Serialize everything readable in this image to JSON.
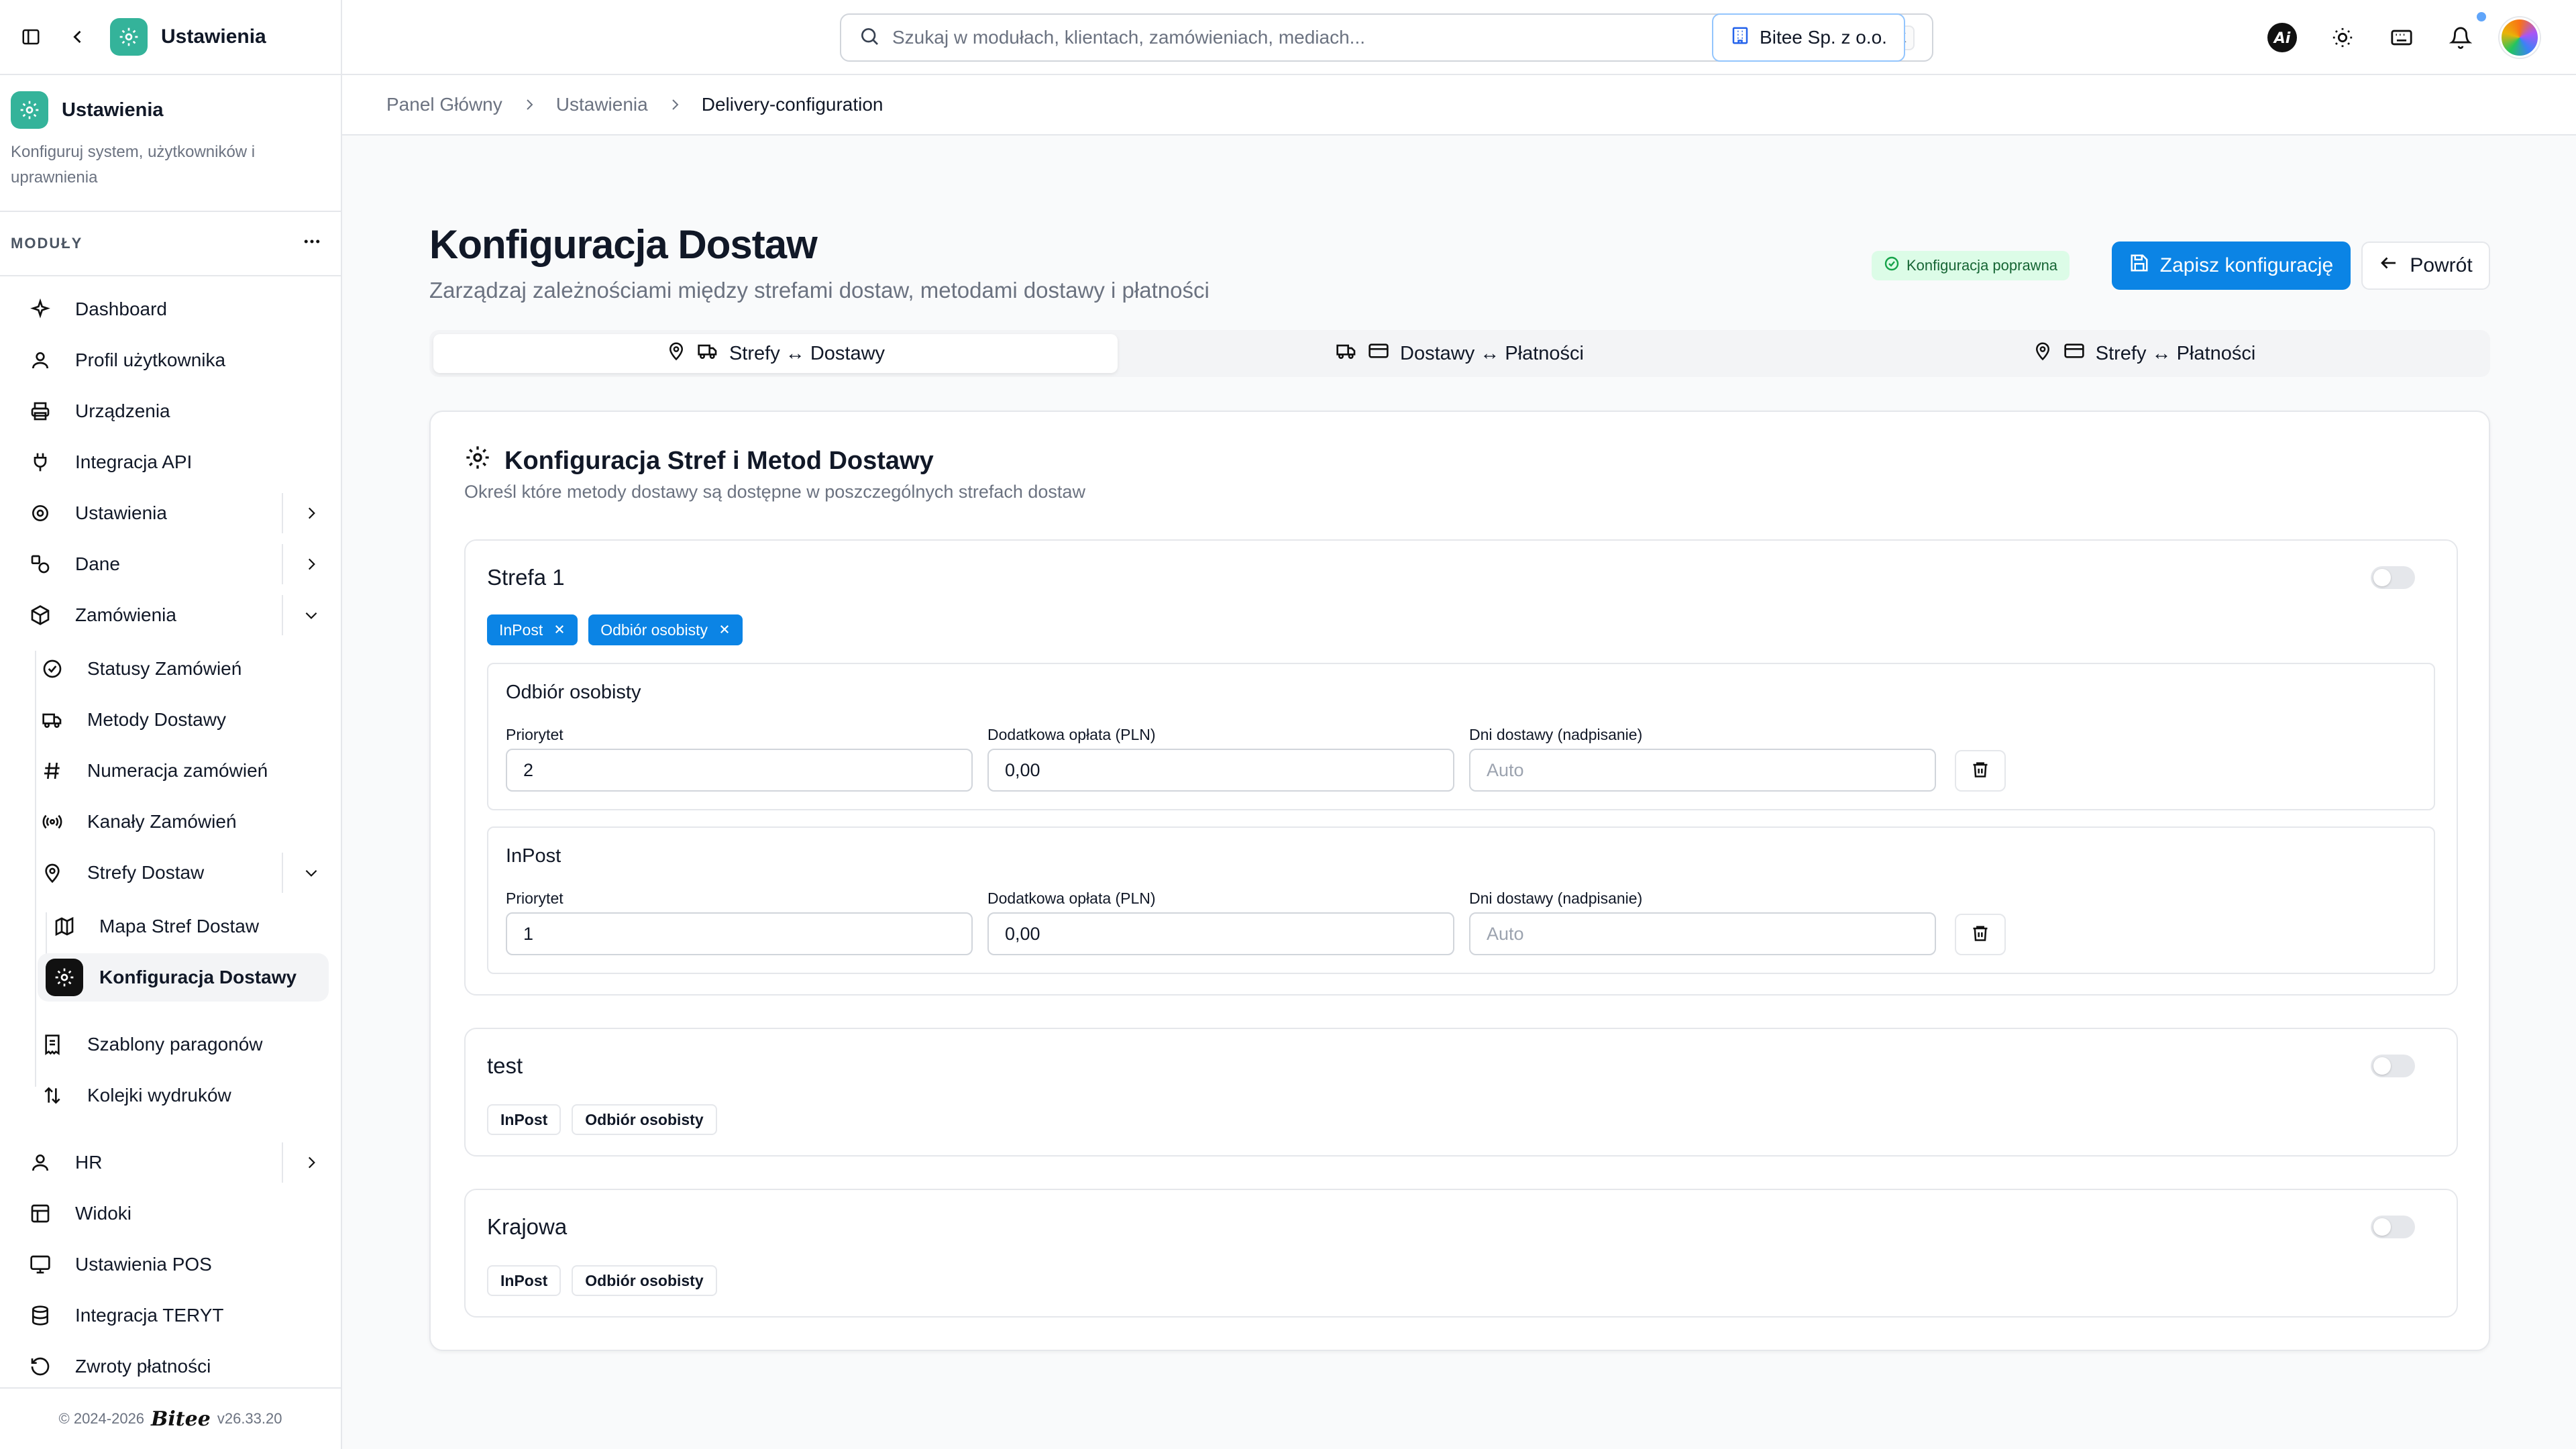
{
  "sidebar": {
    "top_title": "Ustawienia",
    "section_title": "Ustawienia",
    "section_desc": "Konfiguruj system, użytkowników i uprawnienia",
    "modules_label": "MODUŁY",
    "items": [
      {
        "label": "Dashboard",
        "icon": "sparkles-icon"
      },
      {
        "label": "Profil użytkownika",
        "icon": "user-icon"
      },
      {
        "label": "Urządzenia",
        "icon": "printer-icon"
      },
      {
        "label": "Integracja API",
        "icon": "plug-icon"
      },
      {
        "label": "Ustawienia",
        "icon": "gear-icon"
      },
      {
        "label": "Dane",
        "icon": "shapes-icon"
      },
      {
        "label": "Zamówienia",
        "icon": "package-icon"
      },
      {
        "label": "Statusy Zamówień",
        "icon": "check-circle-icon"
      },
      {
        "label": "Metody Dostawy",
        "icon": "truck-icon"
      },
      {
        "label": "Numeracja zamówień",
        "icon": "hash-icon"
      },
      {
        "label": "Kanały Zamówień",
        "icon": "radio-icon"
      },
      {
        "label": "Strefy Dostaw",
        "icon": "map-pin-icon"
      },
      {
        "label": "Mapa Stref Dostaw",
        "icon": "map-icon"
      },
      {
        "label": "Konfiguracja Dostawy",
        "icon": "gear-icon"
      },
      {
        "label": "Szablony paragonów",
        "icon": "receipt-icon"
      },
      {
        "label": "Kolejki wydruków",
        "icon": "arrows-updown-icon"
      },
      {
        "label": "HR",
        "icon": "user-icon"
      },
      {
        "label": "Widoki",
        "icon": "layout-icon"
      },
      {
        "label": "Ustawienia POS",
        "icon": "monitor-icon"
      },
      {
        "label": "Integracja TERYT",
        "icon": "database-icon"
      },
      {
        "label": "Zwroty płatności",
        "icon": "rotate-icon"
      }
    ],
    "footer": {
      "copyright": "© 2024-2026",
      "brand": "Bitee",
      "version": "v26.33.20"
    }
  },
  "topbar": {
    "search_placeholder": "Szukaj w modułach, klientach, zamówieniach, mediach...",
    "search_shortcut": "⌘ K",
    "company": "Bitee Sp. z o.o."
  },
  "breadcrumb": [
    "Panel Główny",
    "Ustawienia",
    "Delivery-configuration"
  ],
  "page": {
    "title": "Konfiguracja Dostaw",
    "subtitle": "Zarządzaj zależnościami między strefami dostaw, metodami dostawy i płatności",
    "status": "Konfiguracja poprawna",
    "save_label": "Zapisz konfigurację",
    "back_label": "Powrót"
  },
  "tabs": [
    {
      "label": "Strefy ↔ Dostawy",
      "active": true
    },
    {
      "label": "Dostawy ↔ Płatności",
      "active": false
    },
    {
      "label": "Strefy ↔ Płatności",
      "active": false
    }
  ],
  "card": {
    "title": "Konfiguracja Stref i Metod Dostawy",
    "subtitle": "Określ które metody dostawy są dostępne w poszczególnych strefach dostaw",
    "field_labels": {
      "priority": "Priorytet",
      "fee": "Dodatkowa opłata (PLN)",
      "days": "Dni dostawy (nadpisanie)"
    },
    "zones": [
      {
        "name": "Strefa 1",
        "enabled": false,
        "chips": [
          "InPost",
          "Odbiór osobisty"
        ],
        "methods": [
          {
            "name": "Odbiór osobisty",
            "priority": "2",
            "fee": "0,00",
            "days_placeholder": "Auto"
          },
          {
            "name": "InPost",
            "priority": "1",
            "fee": "0,00",
            "days_placeholder": "Auto"
          }
        ]
      },
      {
        "name": "test",
        "enabled": false,
        "chips": [
          "InPost",
          "Odbiór osobisty"
        ]
      },
      {
        "name": "Krajowa",
        "enabled": false,
        "chips": [
          "InPost",
          "Odbiór osobisty"
        ]
      }
    ]
  },
  "colors": {
    "accent": "#0b84e5",
    "brand": "#34b39a",
    "success_bg": "#dcfce7",
    "success_text": "#166534"
  }
}
